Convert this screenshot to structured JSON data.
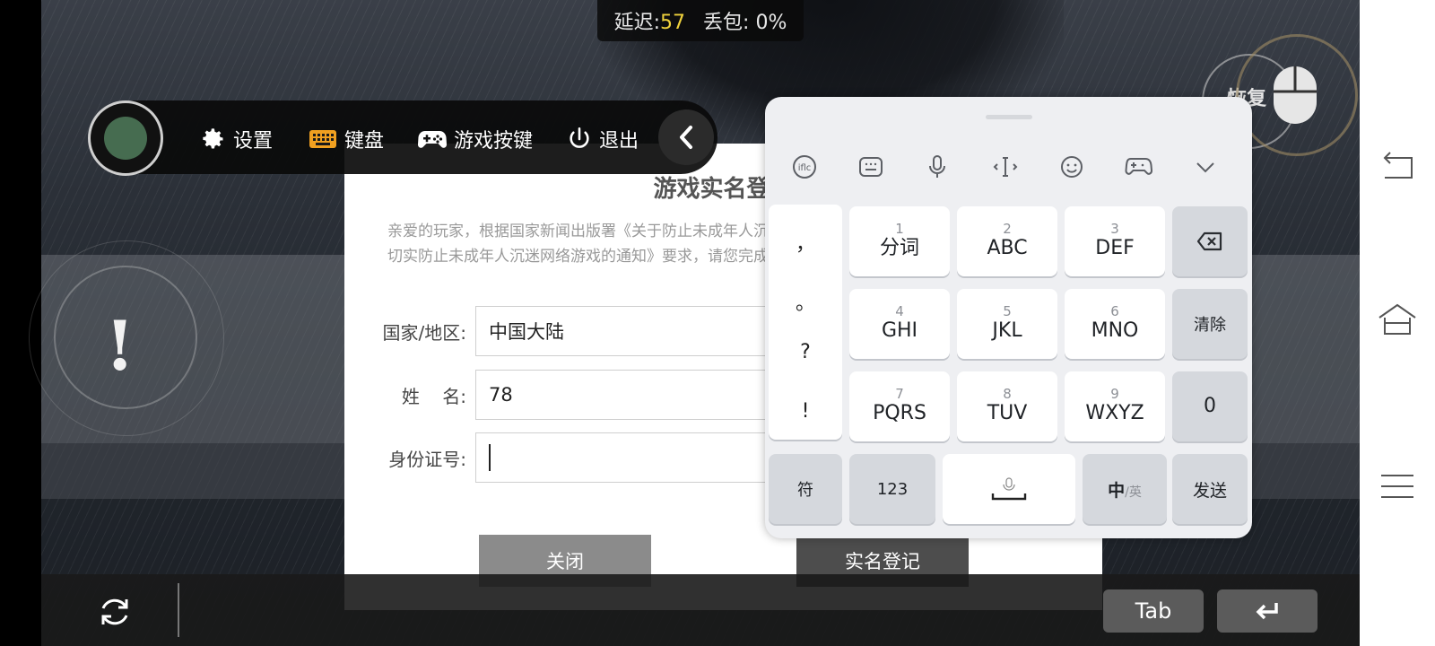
{
  "stats": {
    "latency_label": "延迟:",
    "latency_value": "57",
    "loss_label": "丢包:",
    "loss_value": "0%"
  },
  "toolbar": {
    "settings": "设置",
    "keyboard": "键盘",
    "game_keys": "游戏按键",
    "exit": "退出"
  },
  "dialog": {
    "title": "游戏实名登记",
    "description": "亲爱的玩家，根据国家新闻出版署《关于防止未成年人沉迷网络游戏的通知》要求，进一步严格管理 切实防止未成年人沉迷网络游戏的通知》要求，请您完成实名登记。",
    "fields": [
      {
        "label": "国家/地区:",
        "value": "中国大陆"
      },
      {
        "label": "姓    名:",
        "value": "78"
      },
      {
        "label": "身份证号:",
        "value": ""
      }
    ],
    "close_button": "关闭",
    "register_button": "实名登记"
  },
  "overlay": {
    "restore": "恢复"
  },
  "bottom": {
    "tab_key": "Tab"
  },
  "keyboard": {
    "symbols": [
      "，",
      "。",
      "?",
      "!"
    ],
    "keys": [
      {
        "num": "1",
        "label": "分词"
      },
      {
        "num": "2",
        "label": "ABC"
      },
      {
        "num": "3",
        "label": "DEF"
      },
      {
        "num": "4",
        "label": "GHI"
      },
      {
        "num": "5",
        "label": "JKL"
      },
      {
        "num": "6",
        "label": "MNO"
      },
      {
        "num": "7",
        "label": "PQRS"
      },
      {
        "num": "8",
        "label": "TUV"
      },
      {
        "num": "9",
        "label": "WXYZ"
      }
    ],
    "clear": "清除",
    "zero": "0",
    "symbol_key": "符",
    "num_key": "123",
    "lang_main": "中",
    "lang_sub": "/英",
    "send": "发送"
  }
}
